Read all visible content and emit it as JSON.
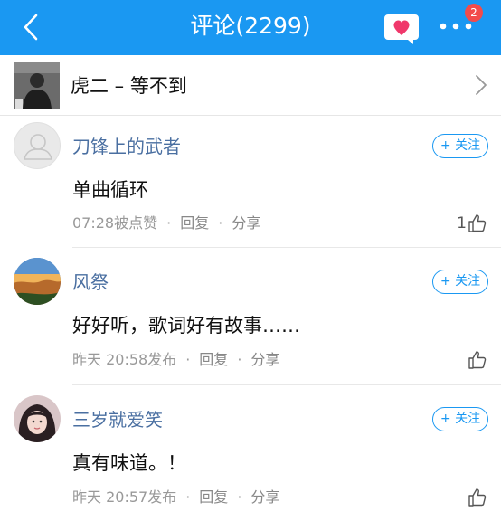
{
  "header": {
    "title": "评论(2299)",
    "back_icon": "chevron-left-icon",
    "fav_icon": "heart-chat-icon",
    "more_icon": "more-dots-icon",
    "more_badge": "2",
    "bg_color": "#1a98f2"
  },
  "song": {
    "title": "虎二 – 等不到",
    "arrow_icon": "chevron-right-icon"
  },
  "comments": [
    {
      "username": "刀锋上的武者",
      "follow_label": "+ 关注",
      "text": "单曲循环",
      "time": "07:28被点赞",
      "reply": "回复",
      "share": "分享",
      "like_count": "1",
      "avatar": "default-avatar"
    },
    {
      "username": "风祭",
      "follow_label": "+ 关注",
      "text": "好好听，歌词好有故事……",
      "time": "昨天 20:58发布",
      "reply": "回复",
      "share": "分享",
      "like_count": "",
      "avatar": "landscape-avatar"
    },
    {
      "username": "三岁就爱笑",
      "follow_label": "+ 关注",
      "text": "真有味道。！",
      "time": "昨天 20:57发布",
      "reply": "回复",
      "share": "分享",
      "like_count": "",
      "avatar": "girl-avatar"
    }
  ]
}
